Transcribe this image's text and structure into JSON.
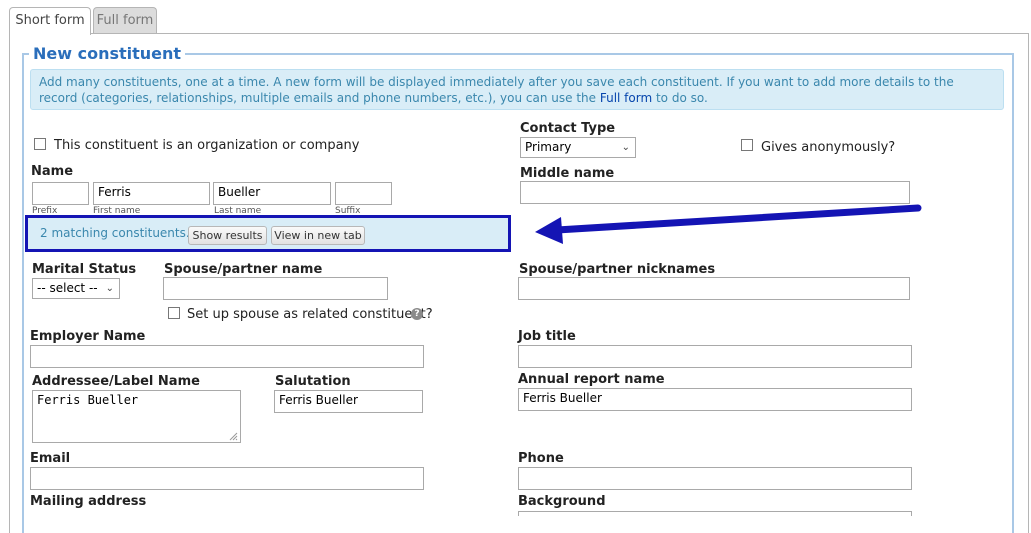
{
  "tabs": [
    "Short form",
    "Full form"
  ],
  "section_title": "New constituent",
  "info": {
    "text_before": "Add many constituents, one at a time. A new form will be displayed immediately after you save each constituent. If you want to add more details to the record (categories, relationships, multiple emails and phone numbers, etc.), you can use the ",
    "link": "Full form",
    "text_after": " to do so."
  },
  "organization_checkbox": "This constituent is an organization or company",
  "contact_type": {
    "label": "Contact Type",
    "value": "Primary"
  },
  "gives_anonymously": "Gives anonymously?",
  "name": {
    "label": "Name",
    "prefix": "",
    "first": "Ferris",
    "last": "Bueller",
    "suffix": "",
    "prefix_caption": "Prefix",
    "first_caption": "First name",
    "last_caption": "Last name",
    "suffix_caption": "Suffix"
  },
  "middle_name": {
    "label": "Middle name",
    "value": ""
  },
  "matching": {
    "text": "2 matching constituents.",
    "show_results": "Show results",
    "view_new_tab": "View in new tab",
    "highlight_color": "#1414b4"
  },
  "marital_status": {
    "label": "Marital Status",
    "value": "-- select --"
  },
  "spouse_name": {
    "label": "Spouse/partner name",
    "value": ""
  },
  "spouse_nicknames": {
    "label": "Spouse/partner nicknames",
    "value": ""
  },
  "spouse_related": "Set up spouse as related constituent?",
  "employer": {
    "label": "Employer Name",
    "value": ""
  },
  "job_title": {
    "label": "Job title",
    "value": ""
  },
  "addressee": {
    "label": "Addressee/Label Name",
    "value": "Ferris Bueller"
  },
  "salutation": {
    "label": "Salutation",
    "value": "Ferris Bueller"
  },
  "annual_report": {
    "label": "Annual report name",
    "value": "Ferris Bueller"
  },
  "email": {
    "label": "Email",
    "value": ""
  },
  "phone": {
    "label": "Phone",
    "value": ""
  },
  "mailing_address": {
    "label": "Mailing address"
  },
  "background": {
    "label": "Background"
  }
}
